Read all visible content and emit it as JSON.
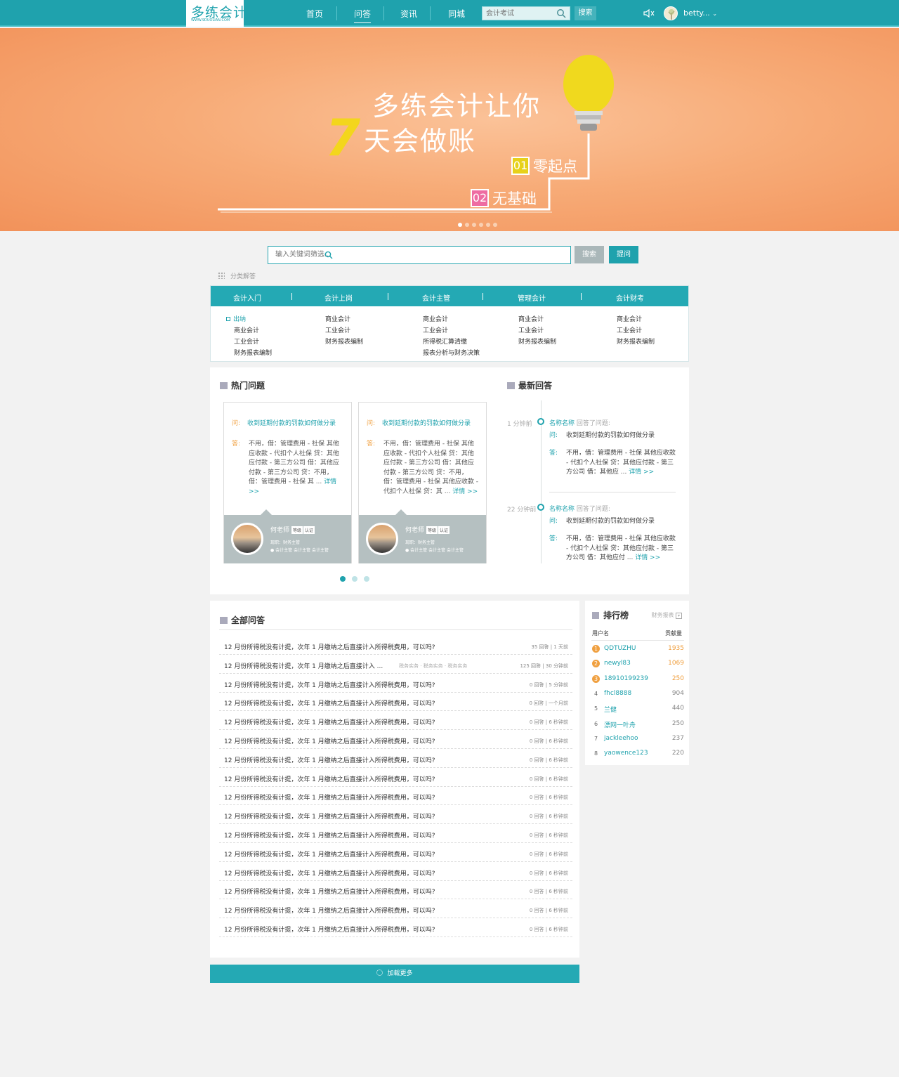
{
  "brand": {
    "logo": "多练会计",
    "logo_sub": "WWW.9DUOLIAN.COM",
    "accent": "#1fa2ad",
    "orange": "#f0a040"
  },
  "nav": {
    "items": [
      "首页",
      "问答",
      "资讯",
      "同城"
    ],
    "active": "问答",
    "search_placeholder": "会计考试",
    "search_button": "搜索",
    "user": "betty..."
  },
  "banner": {
    "title_line1": "多练会计让你",
    "number": "7",
    "title_line2": "天会做账",
    "tag1_num": "01",
    "tag1_text": "零起点",
    "tag2_num": "02",
    "tag2_text": "无基础",
    "slides": 6,
    "active_slide": 1
  },
  "search": {
    "placeholder": "输入关键词筛选...",
    "search_button": "搜索",
    "ask_button": "提问"
  },
  "categories": {
    "label": "分类解答",
    "columns": [
      {
        "title": "会计入门",
        "items": [
          "出纳",
          "商业会计",
          "工业会计",
          "财务报表编制"
        ]
      },
      {
        "title": "会计上岗",
        "items": [
          "商业会计",
          "工业会计",
          "财务报表编制"
        ]
      },
      {
        "title": "会计主管",
        "items": [
          "商业会计",
          "工业会计",
          "所得税汇算清缴",
          "报表分析与财务决策"
        ]
      },
      {
        "title": "管理会计",
        "items": [
          "商业会计",
          "工业会计",
          "财务报表编制"
        ]
      },
      {
        "title": "会计财考",
        "items": [
          "商业会计",
          "工业会计",
          "财务报表编制"
        ]
      }
    ]
  },
  "hot": {
    "title": "热门问题",
    "cards": [
      {
        "q_label": "问:",
        "question": "收到延期付款的罚款如何做分录",
        "a_label": "答:",
        "answer": "不用，借：管理费用 - 社保 其他应收款 - 代扣个人社保 贷：其他应付款 - 第三方公司 借：其他应付款 - 第三方公司 贷：不用，借：管理费用 - 社保 其 ...",
        "more": "详情 >>",
        "name": "何老师",
        "badge1": "等级",
        "badge2": "认证",
        "job": "现职：财务主管",
        "tags": "会计主管  会计主管  会计主管"
      },
      {
        "q_label": "问:",
        "question": "收到延期付款的罚款如何做分录",
        "a_label": "答:",
        "answer": "不用，借：管理费用 - 社保 其他应收款 - 代扣个人社保 贷：其他应付款 - 第三方公司 借：其他应付款 - 第三方公司 贷：不用，借：管理费用 - 社保 其他应收款 - 代扣个人社保 贷：其 ...",
        "more": "详情 >>",
        "name": "何老师",
        "badge1": "等级",
        "badge2": "认证",
        "job": "现职：财务主管",
        "tags": "会计主管  会计主管  会计主管"
      }
    ],
    "pages": 3,
    "active_page": 1
  },
  "latest": {
    "title": "最新回答",
    "items": [
      {
        "time": "1 分钟前",
        "name": "名称名称",
        "action": "回答了问题:",
        "q_label": "问:",
        "question": "收到延期付款的罚款如何做分录",
        "a_label": "答:",
        "answer": "不用，借：管理费用 - 社保 其他应收款 - 代扣个人社保 贷：其他应付款 - 第三方公司 借：其他应 ...",
        "more": "详情 >>"
      },
      {
        "time": "22 分钟前",
        "name": "名称名称",
        "action": "回答了问题:",
        "q_label": "问:",
        "question": "收到延期付款的罚款如何做分录",
        "a_label": "答:",
        "answer": "不用，借：管理费用 - 社保 其他应收款 - 代扣个人社保 贷：其他应付款 - 第三方公司 借：其他应付 ...",
        "more": "详情 >>"
      }
    ]
  },
  "all": {
    "title": "全部问答",
    "rows": [
      {
        "title": "12 月份所得税没有计提，次年 1 月缴纳之后直接计入所得税费用，可以吗?",
        "meta": "35 回答 | 1 天前",
        "tags": ""
      },
      {
        "title": "12 月份所得税没有计提，次年 1 月缴纳之后直接计入 ...",
        "meta": "125 回答 | 30 分钟前",
        "tags": "税务实务 · 税务实务 · 税务实务"
      },
      {
        "title": "12 月份所得税没有计提，次年 1 月缴纳之后直接计入所得税费用，可以吗?",
        "meta": "0 回答 | 5 分钟前",
        "tags": ""
      },
      {
        "title": "12 月份所得税没有计提，次年 1 月缴纳之后直接计入所得税费用，可以吗?",
        "meta": "0 回答 | 一个月前",
        "tags": ""
      },
      {
        "title": "12 月份所得税没有计提，次年 1 月缴纳之后直接计入所得税费用，可以吗?",
        "meta": "0 回答 | 6 秒钟前",
        "tags": ""
      },
      {
        "title": "12 月份所得税没有计提，次年 1 月缴纳之后直接计入所得税费用，可以吗?",
        "meta": "0 回答 | 6 秒钟前",
        "tags": ""
      },
      {
        "title": "12 月份所得税没有计提，次年 1 月缴纳之后直接计入所得税费用，可以吗?",
        "meta": "0 回答 | 6 秒钟前",
        "tags": ""
      },
      {
        "title": "12 月份所得税没有计提，次年 1 月缴纳之后直接计入所得税费用，可以吗?",
        "meta": "0 回答 | 6 秒钟前",
        "tags": ""
      },
      {
        "title": "12 月份所得税没有计提，次年 1 月缴纳之后直接计入所得税费用，可以吗?",
        "meta": "0 回答 | 6 秒钟前",
        "tags": ""
      },
      {
        "title": "12 月份所得税没有计提，次年 1 月缴纳之后直接计入所得税费用，可以吗?",
        "meta": "0 回答 | 6 秒钟前",
        "tags": ""
      },
      {
        "title": "12 月份所得税没有计提，次年 1 月缴纳之后直接计入所得税费用，可以吗?",
        "meta": "0 回答 | 6 秒钟前",
        "tags": ""
      },
      {
        "title": "12 月份所得税没有计提，次年 1 月缴纳之后直接计入所得税费用，可以吗?",
        "meta": "0 回答 | 6 秒钟前",
        "tags": ""
      },
      {
        "title": "12 月份所得税没有计提，次年 1 月缴纳之后直接计入所得税费用，可以吗?",
        "meta": "0 回答 | 6 秒钟前",
        "tags": ""
      },
      {
        "title": "12 月份所得税没有计提，次年 1 月缴纳之后直接计入所得税费用，可以吗?",
        "meta": "0 回答 | 6 秒钟前",
        "tags": ""
      },
      {
        "title": "12 月份所得税没有计提，次年 1 月缴纳之后直接计入所得税费用，可以吗?",
        "meta": "0 回答 | 6 秒钟前",
        "tags": ""
      },
      {
        "title": "12 月份所得税没有计提，次年 1 月缴纳之后直接计入所得税费用，可以吗?",
        "meta": "0 回答 | 6 秒钟前",
        "tags": ""
      }
    ],
    "load_more": "加载更多"
  },
  "ranking": {
    "title": "排行榜",
    "filter": "财务报表",
    "col_user": "用户名",
    "col_score": "贡献量",
    "rows": [
      {
        "rank": "1",
        "user": "QDTUZHU",
        "score": "1935"
      },
      {
        "rank": "2",
        "user": "newyl83",
        "score": "1069"
      },
      {
        "rank": "3",
        "user": "18910199239",
        "score": "250"
      },
      {
        "rank": "4",
        "user": "fhcl8888",
        "score": "904"
      },
      {
        "rank": "5",
        "user": "兰健",
        "score": "440"
      },
      {
        "rank": "6",
        "user": "漂网一叶舟",
        "score": "250"
      },
      {
        "rank": "7",
        "user": "jackleehoo",
        "score": "237"
      },
      {
        "rank": "8",
        "user": "yaowence123",
        "score": "220"
      }
    ]
  }
}
